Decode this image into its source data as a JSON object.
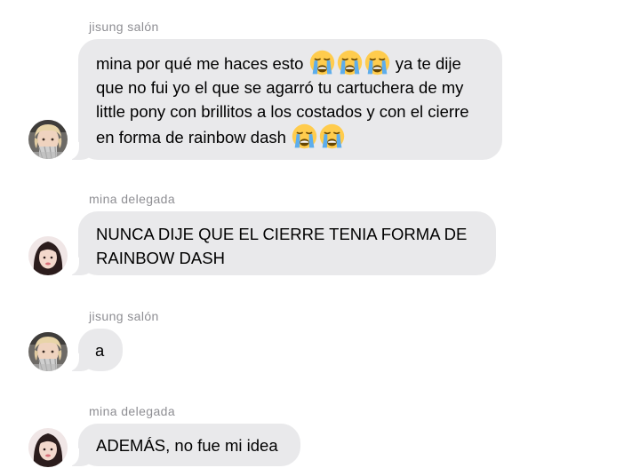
{
  "messages": [
    {
      "sender": "jisung salón",
      "avatar_icon": "photo-avatar-blonde",
      "text_lines": [
        "mina por qué me haces esto",
        "ya te dije",
        "que no fui yo el que se agarró tu cartuchera de my",
        "little pony con brillitos a los costados y con el cierre",
        "en forma de rainbow dash"
      ],
      "emoji": "loudly-crying-face-icon"
    },
    {
      "sender": "mina delegada",
      "avatar_icon": "photo-avatar-dark-hair",
      "text_lines": [
        "NUNCA DIJE QUE EL CIERRE TENIA FORMA DE",
        "RAINBOW DASH"
      ]
    },
    {
      "sender": "jisung salón",
      "avatar_icon": "photo-avatar-blonde",
      "text_lines": [
        "a"
      ]
    },
    {
      "sender": "mina delegada",
      "avatar_icon": "photo-avatar-dark-hair",
      "text_lines": [
        "ADEMÁS, no fue mi idea"
      ]
    }
  ],
  "colors": {
    "bubble": "#e9e9eb",
    "sender_name": "#8e8e93",
    "background": "#ffffff"
  }
}
